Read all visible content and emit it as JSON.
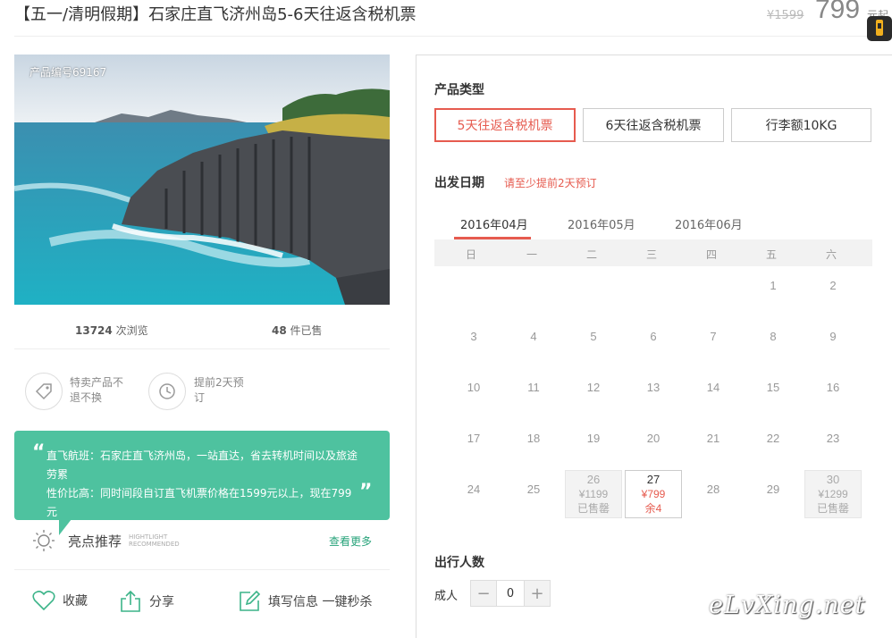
{
  "header": {
    "title": "【五一/清明假期】石家庄直飞济州岛5-6天往返含税机票",
    "original_price": "¥1599",
    "price": "799",
    "price_unit": "元起"
  },
  "hero": {
    "product_code": "产品编号69167"
  },
  "stats": {
    "views_count": "13724",
    "views_label": "次浏览",
    "sold_count": "48",
    "sold_label": "件已售"
  },
  "features": [
    {
      "icon": "tag-icon",
      "line1": "特卖产品不",
      "line2": "退不换"
    },
    {
      "icon": "clock-icon",
      "line1": "提前2天预",
      "line2": "订"
    }
  ],
  "highlight": {
    "line1": "直飞航班：石家庄直飞济州岛，一站直达，省去转机时间以及旅途劳累",
    "line2": "性价比高：同时间段自订直飞机票价格在1599元以上，现在799元",
    "quote_open": "“",
    "quote_close": "”"
  },
  "recommend": {
    "title": "亮点推荐",
    "en_line1": "HIGHTLIGHT",
    "en_line2": "RECOMMENDED",
    "see_more": "查看更多"
  },
  "actions": {
    "favorite": "收藏",
    "share": "分享",
    "fill_info": "填写信息 一键秒杀"
  },
  "product_type": {
    "title": "产品类型",
    "options": [
      "5天往返含税机票",
      "6天往返含税机票",
      "行李额10KG"
    ]
  },
  "departure": {
    "title": "出发日期",
    "note": "请至少提前2天预订",
    "months": [
      "2016年04月",
      "2016年05月",
      "2016年06月"
    ],
    "weekdays": [
      "日",
      "一",
      "二",
      "三",
      "四",
      "五",
      "六"
    ],
    "days": [
      {
        "d": "1"
      },
      {
        "d": "2"
      },
      {
        "d": "3"
      },
      {
        "d": "4"
      },
      {
        "d": "5"
      },
      {
        "d": "6"
      },
      {
        "d": "7"
      },
      {
        "d": "8"
      },
      {
        "d": "9"
      },
      {
        "d": "10"
      },
      {
        "d": "11"
      },
      {
        "d": "12"
      },
      {
        "d": "13"
      },
      {
        "d": "14"
      },
      {
        "d": "15"
      },
      {
        "d": "16"
      },
      {
        "d": "17"
      },
      {
        "d": "18"
      },
      {
        "d": "19"
      },
      {
        "d": "20"
      },
      {
        "d": "21"
      },
      {
        "d": "22"
      },
      {
        "d": "23"
      },
      {
        "d": "24"
      },
      {
        "d": "25"
      },
      {
        "d": "26",
        "price": "¥1199",
        "status": "已售罄",
        "state": "soldout"
      },
      {
        "d": "27",
        "price": "¥799",
        "status": "余4",
        "state": "available"
      },
      {
        "d": "28"
      },
      {
        "d": "29"
      },
      {
        "d": "30",
        "price": "¥1299",
        "status": "已售罄",
        "state": "soldout"
      }
    ]
  },
  "travelers": {
    "title": "出行人数",
    "adult_label": "成人",
    "minus": "−",
    "value": "0",
    "plus": "+"
  },
  "watermark": "eLvXing.net",
  "colors": {
    "accent": "#e65b4f",
    "highlight_bg": "#4ec29f",
    "link_green": "#27a37a"
  }
}
